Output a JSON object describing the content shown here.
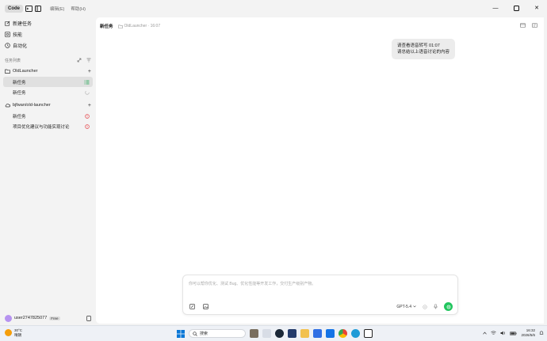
{
  "topbar": {
    "code_label": "Code",
    "menu": [
      "编辑(E)",
      "帮助(H)"
    ]
  },
  "sidebar": {
    "nav": [
      {
        "label": "新建任务",
        "icon": "edit-icon"
      },
      {
        "label": "技能",
        "icon": "skills-icon"
      },
      {
        "label": "自动化",
        "icon": "automation-icon"
      }
    ],
    "section_title": "任务列表",
    "groups": [
      {
        "name": "OldLauncher",
        "icon": "folder-icon",
        "tasks": [
          {
            "label": "新任务",
            "status": "list",
            "active": true
          },
          {
            "label": "新任务",
            "status": "loading",
            "active": false
          }
        ]
      },
      {
        "name": "bjfwan/old-launcher",
        "icon": "cloud-icon",
        "tasks": [
          {
            "label": "新任务",
            "status": "error",
            "active": false
          },
          {
            "label": "项目优化建议与功能实现讨论",
            "status": "error",
            "active": false
          }
        ]
      }
    ],
    "user": {
      "name": "user2747825077",
      "plan": "Free"
    }
  },
  "main": {
    "title": "新任务",
    "breadcrumb": "OldLauncher · 16:07",
    "message_lines": [
      "请查看语音转写 01:07",
      "请总结以上语音讨论的内容"
    ],
    "composer": {
      "placeholder": "你可以帮你优化、测试 Bug、优化性能等开发工作，交付生产级别产物。",
      "model": "GPT-5.4"
    }
  },
  "taskbar": {
    "temp": "30°C",
    "weather": "晴朗",
    "search": "搜索",
    "time": "16:32",
    "date": "2026/5/6"
  },
  "colors": {
    "send": "#22c55e",
    "accent_error": "#e5484d",
    "active_task_bg": "#e0e0e0"
  }
}
